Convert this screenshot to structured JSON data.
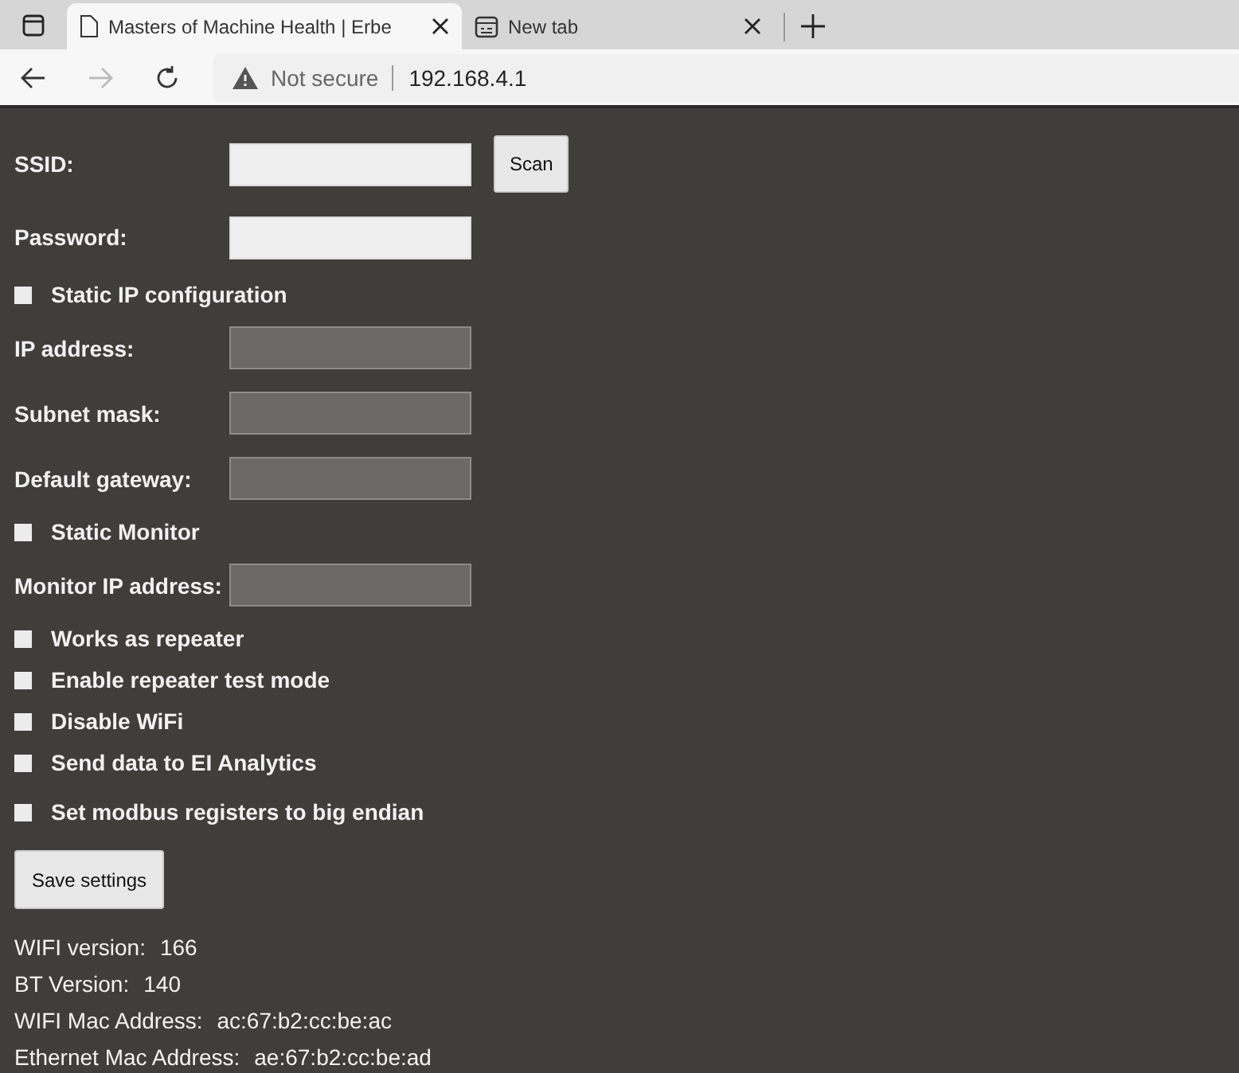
{
  "browser": {
    "tabs": [
      {
        "title": "Masters of Machine Health | Erbe",
        "kind": "page",
        "selected": true
      },
      {
        "title": "New tab",
        "kind": "newtab",
        "selected": false
      }
    ],
    "security": "Not secure",
    "url": "192.168.4.1"
  },
  "form": [
    {
      "kind": "field",
      "label": "SSID:",
      "disabled": false,
      "button": "Scan"
    },
    {
      "kind": "field",
      "label": "Password:",
      "disabled": false
    },
    {
      "kind": "checkbox",
      "label": "Static IP configuration",
      "checked": false
    },
    {
      "kind": "field",
      "label": "IP address:",
      "disabled": true
    },
    {
      "kind": "field",
      "label": "Subnet mask:",
      "disabled": true
    },
    {
      "kind": "field",
      "label": "Default gateway:",
      "disabled": true
    },
    {
      "kind": "checkbox",
      "label": "Static Monitor",
      "checked": false
    },
    {
      "kind": "field",
      "label": "Monitor IP address:",
      "disabled": true
    },
    {
      "kind": "checkbox",
      "label": "Works as repeater",
      "checked": false
    },
    {
      "kind": "checkbox",
      "label": "Enable repeater test mode",
      "checked": false
    },
    {
      "kind": "checkbox",
      "label": "Disable WiFi",
      "checked": false
    },
    {
      "kind": "checkbox",
      "label": "Send data to EI Analytics",
      "checked": false
    },
    {
      "kind": "checkbox",
      "label": "Set modbus registers to big endian",
      "checked": false
    }
  ],
  "save_button": "Save settings",
  "info": [
    {
      "label": "WIFI version:",
      "value": "166"
    },
    {
      "label": "BT Version:",
      "value": "140"
    },
    {
      "label": "WIFI Mac Address:",
      "value": "ac:67:b2:cc:be:ac"
    },
    {
      "label": "Ethernet Mac Address:",
      "value": "ae:67:b2:cc:be:ad"
    }
  ]
}
